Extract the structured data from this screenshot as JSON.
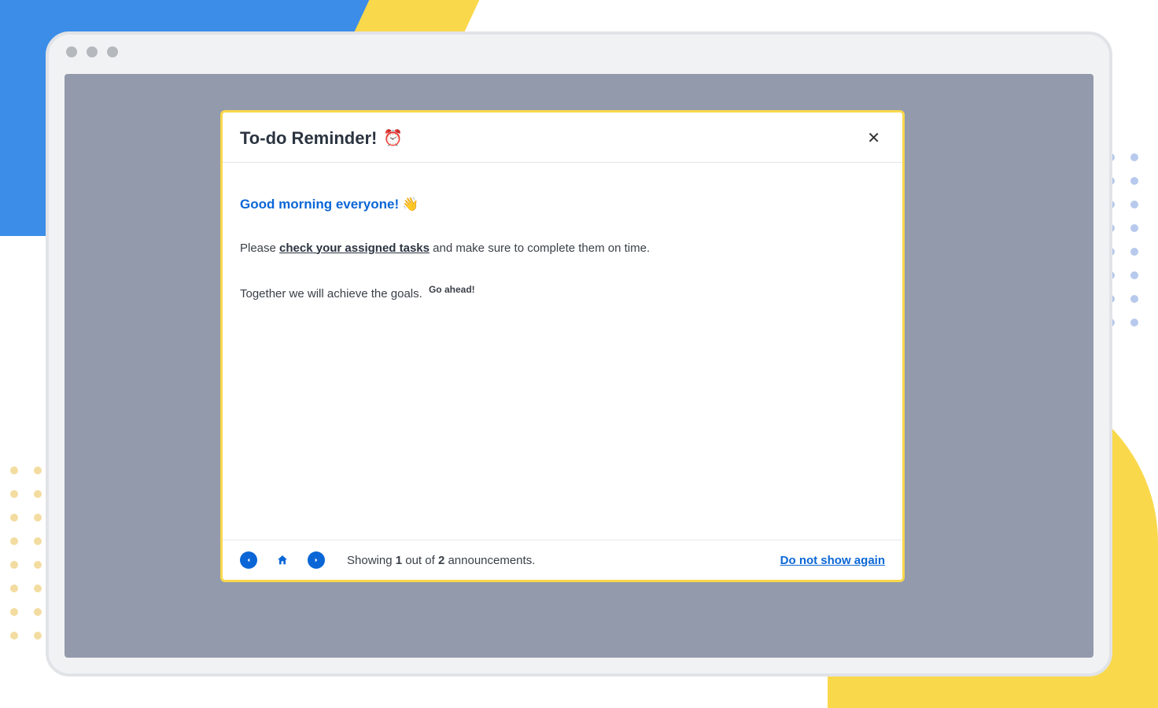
{
  "modal": {
    "title": "To-do Reminder!",
    "title_emoji": "⏰",
    "greeting": "Good morning everyone!",
    "greeting_emoji": "👋",
    "body_prefix": "Please ",
    "body_link": "check your assigned tasks",
    "body_suffix": " and make sure to complete them on time.",
    "line2_prefix": "Together we will achieve the goals. ",
    "line2_tag": "Go ahead!"
  },
  "footer": {
    "showing_prefix": "Showing ",
    "current": "1",
    "mid": " out of ",
    "total": "2",
    "suffix": " announcements.",
    "do_not_show": "Do not show again"
  }
}
